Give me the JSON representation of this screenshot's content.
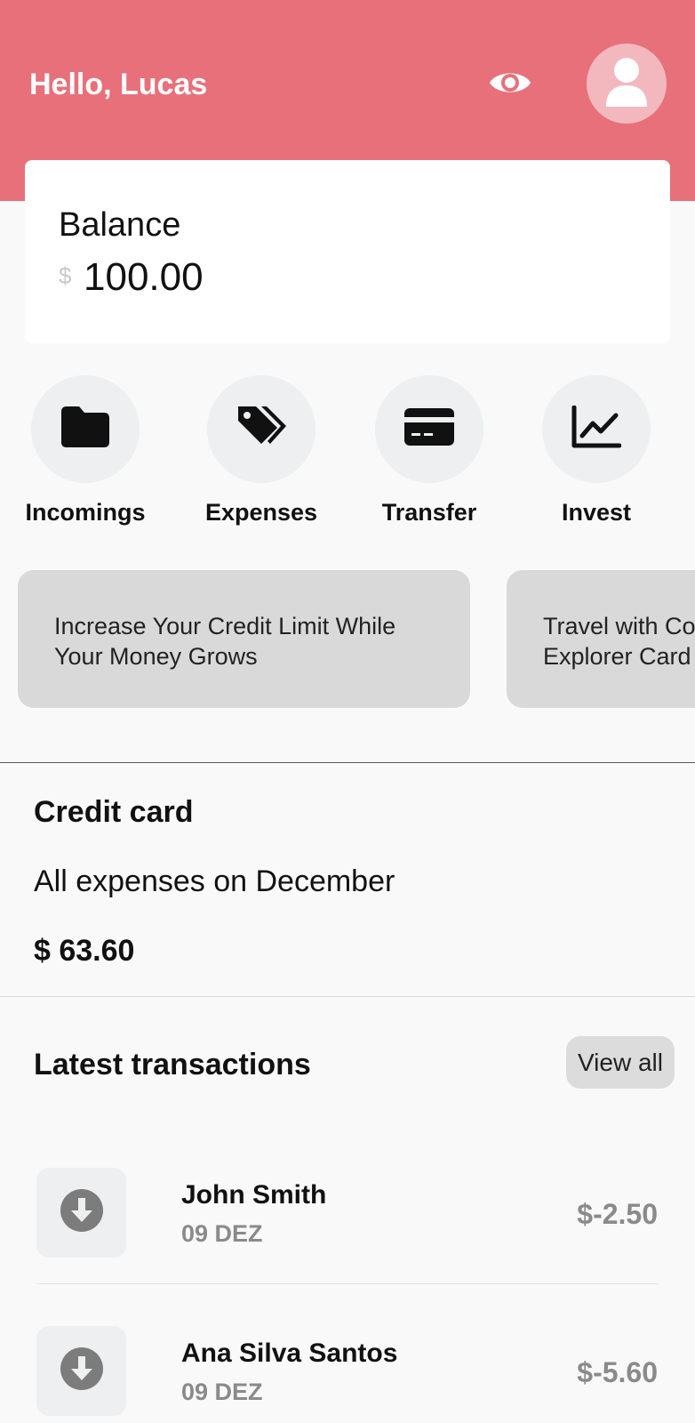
{
  "colors": {
    "header_bg": "#e8707a",
    "avatar_bg": "#f3b8bd",
    "card_bg": "#ffffff",
    "circle_bg": "#edeff0",
    "promo_bg": "#d9d9d9",
    "muted_text": "#8a8a8a"
  },
  "header": {
    "greeting": "Hello, Lucas",
    "visibility_icon": "eye-icon",
    "avatar_icon": "user-icon"
  },
  "balance": {
    "label": "Balance",
    "currency": "$",
    "value": "100.00"
  },
  "actions": [
    {
      "label": "Incomings",
      "icon": "folder-icon"
    },
    {
      "label": "Expenses",
      "icon": "tags-icon"
    },
    {
      "label": "Transfer",
      "icon": "credit-card-icon"
    },
    {
      "label": "Invest",
      "icon": "line-chart-icon"
    }
  ],
  "promos": [
    {
      "text": "Increase Your Credit Limit While Your Money Grows"
    },
    {
      "text": "Travel with Co Explorer Card"
    }
  ],
  "credit_card": {
    "title": "Credit card",
    "subtitle": "All expenses on December",
    "amount": "$ 63.60"
  },
  "transactions": {
    "title": "Latest transactions",
    "view_all_label": "View all",
    "items": [
      {
        "name": "John Smith",
        "date": "09 DEZ",
        "amount": "$-2.50",
        "icon": "arrow-down-circle-icon"
      },
      {
        "name": "Ana Silva Santos",
        "date": "09 DEZ",
        "amount": "$-5.60",
        "icon": "arrow-down-circle-icon"
      }
    ]
  }
}
